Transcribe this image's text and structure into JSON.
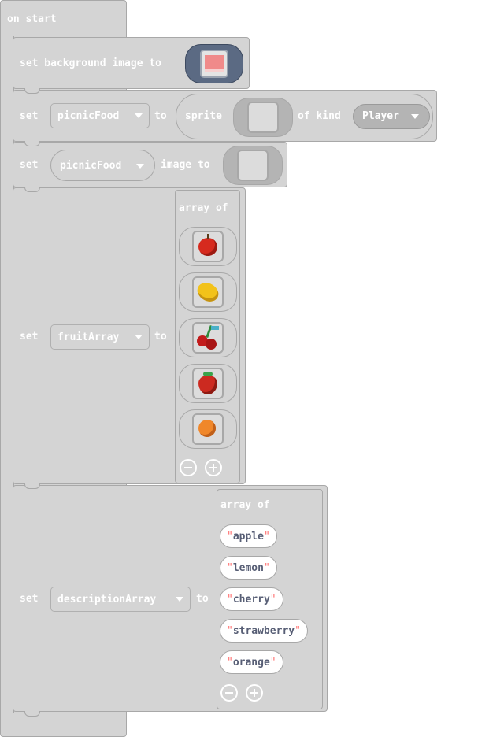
{
  "on_start": {
    "label": "on start"
  },
  "set_background": {
    "label": "set background image to",
    "image_icon": "picnic-background-icon"
  },
  "set_sprite": {
    "set_label": "set",
    "variable": "picnicFood",
    "to_label": "to",
    "sprite_label": "sprite",
    "sprite_icon": "blank-image-icon",
    "of_kind_label": "of kind",
    "kind": "Player"
  },
  "set_image": {
    "set_label": "set",
    "variable": "picnicFood",
    "image_to_label": "image to",
    "image_icon": "blank-image-icon"
  },
  "set_fruit": {
    "set_label": "set",
    "variable": "fruitArray",
    "to_label": "to",
    "array_label": "array of",
    "items": [
      {
        "icon": "apple-icon",
        "color": "#d62a1e"
      },
      {
        "icon": "lemon-icon",
        "color": "#f2c21a"
      },
      {
        "icon": "cherry-icon",
        "color": "#c21b1b"
      },
      {
        "icon": "strawberry-icon",
        "color": "#cc2a20"
      },
      {
        "icon": "orange-icon",
        "color": "#f0872a"
      }
    ],
    "remove_icon": "minus-circle-icon",
    "add_icon": "plus-circle-icon"
  },
  "set_description": {
    "set_label": "set",
    "variable": "descriptionArray",
    "to_label": "to",
    "array_label": "array of",
    "items": [
      "apple",
      "lemon",
      "cherry",
      "strawberry",
      "orange"
    ],
    "remove_icon": "minus-circle-icon",
    "add_icon": "plus-circle-icon"
  },
  "colors": {
    "block_fill": "#d4d4d4",
    "block_border": "#a8a8a8",
    "text": "#ffffff",
    "string_text": "#575e75",
    "quote": "#ff6f6f"
  }
}
